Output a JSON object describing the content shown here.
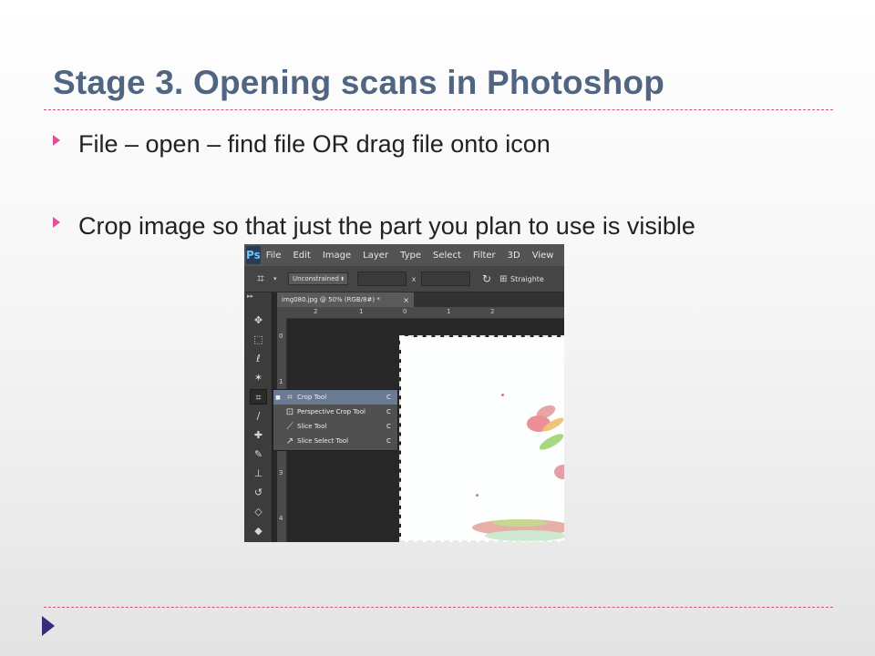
{
  "slide": {
    "title": "Stage 3. Opening scans in Photoshop",
    "bullets": [
      "File – open – find file OR drag file onto icon",
      "Crop image so that just the part you plan to use is visible"
    ],
    "colors": {
      "title": "#4f6581",
      "accent": "#e2509a",
      "divider": "#d0528a",
      "footer_marker": "#3b2a7a"
    }
  },
  "photoshop": {
    "logo": "Ps",
    "menu": [
      "File",
      "Edit",
      "Image",
      "Layer",
      "Type",
      "Select",
      "Filter",
      "3D",
      "View",
      "W"
    ],
    "options_bar": {
      "constraint": "Unconstrained",
      "swap_icon": "x",
      "straighten_label": "Straighte"
    },
    "document_tab": {
      "label": "img080.jpg @ 50% (RGB/8#) *",
      "close": "×"
    },
    "ruler_h_labels": [
      "2",
      "1",
      "0",
      "1",
      "2"
    ],
    "ruler_v_labels": [
      "0",
      "1",
      "2",
      "3",
      "4"
    ],
    "tools_icons": [
      "move-icon",
      "marquee-icon",
      "lasso-icon",
      "magic-wand-icon",
      "crop-icon",
      "eyedropper-icon",
      "healing-brush-icon",
      "brush-icon",
      "clone-stamp-icon",
      "history-brush-icon",
      "eraser-icon",
      "paint-bucket-icon"
    ],
    "flyout": [
      {
        "label": "Crop Tool",
        "key": "C",
        "selected": true,
        "icon": "crop-icon"
      },
      {
        "label": "Perspective Crop Tool",
        "key": "C",
        "selected": false,
        "icon": "perspective-crop-icon"
      },
      {
        "label": "Slice Tool",
        "key": "C",
        "selected": false,
        "icon": "slice-icon"
      },
      {
        "label": "Slice Select Tool",
        "key": "C",
        "selected": false,
        "icon": "slice-select-icon"
      }
    ]
  }
}
